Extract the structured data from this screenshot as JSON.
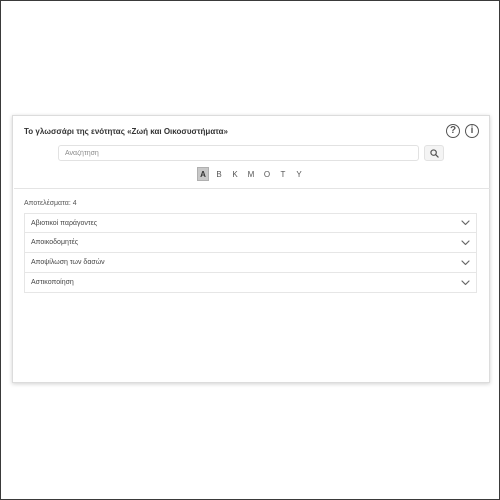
{
  "glossary": {
    "title": "Το γλωσσάρι της ενότητας «Ζωή και Οικοσυστήματα»",
    "help_symbol": "?",
    "info_symbol": "i",
    "search": {
      "placeholder": "Αναζήτηση",
      "value": ""
    },
    "letters": [
      {
        "label": "Α",
        "active": true
      },
      {
        "label": "Β",
        "active": false
      },
      {
        "label": "Κ",
        "active": false
      },
      {
        "label": "Μ",
        "active": false
      },
      {
        "label": "Ο",
        "active": false
      },
      {
        "label": "Τ",
        "active": false
      },
      {
        "label": "Υ",
        "active": false
      }
    ],
    "results_label": "Αποτελέσματα: 4",
    "results": [
      {
        "label": "Αβιοτικοί παράγοντες"
      },
      {
        "label": "Αποικοδομητές"
      },
      {
        "label": "Αποψίλωση των δασών"
      },
      {
        "label": "Αστικοποίηση"
      }
    ]
  },
  "icons": {
    "help": "question-circle-icon",
    "info": "info-circle-icon",
    "search": "magnifier-icon",
    "expand": "chevron-down-icon"
  },
  "colors": {
    "active_letter_bg": "#c8c8c8",
    "border": "#e6e6e6",
    "text": "#444444"
  }
}
